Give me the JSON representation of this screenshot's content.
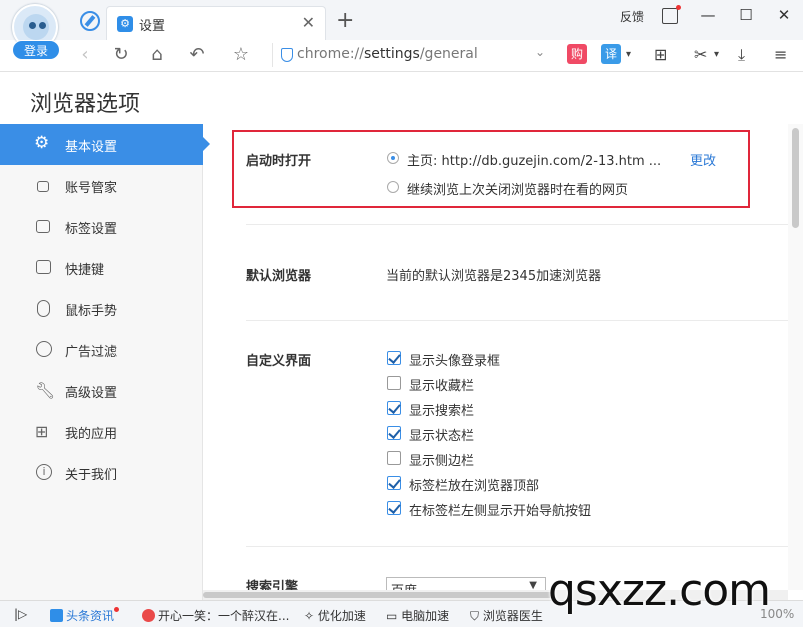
{
  "titlebar": {
    "login_label": "登录",
    "tab_title": "设置",
    "tab_close": "✕",
    "new_tab": "+",
    "feedback": "反馈",
    "minimize": "—",
    "maximize": "☐",
    "close": "✕"
  },
  "addressbar": {
    "url_scheme": "chrome://",
    "url_host": "settings",
    "url_path": "/general",
    "gou_label": "购",
    "yi_label": "译"
  },
  "page": {
    "title": "浏览器选项"
  },
  "sidebar": {
    "items": [
      {
        "label": "基本设置",
        "icon": "gear-icon"
      },
      {
        "label": "账号管家",
        "icon": "lock-icon"
      },
      {
        "label": "标签设置",
        "icon": "tabs-icon"
      },
      {
        "label": "快捷键",
        "icon": "keyboard-icon"
      },
      {
        "label": "鼠标手势",
        "icon": "mouse-icon"
      },
      {
        "label": "广告过滤",
        "icon": "block-icon"
      },
      {
        "label": "高级设置",
        "icon": "wrench-icon"
      },
      {
        "label": "我的应用",
        "icon": "apps-icon"
      },
      {
        "label": "关于我们",
        "icon": "info-icon"
      }
    ]
  },
  "startup": {
    "label": "启动时打开",
    "homepage_option": "主页: http://db.guzejin.com/2-13.htm ...",
    "change_link": "更改",
    "continue_option": "继续浏览上次关闭浏览器时在看的网页"
  },
  "default_browser": {
    "label": "默认浏览器",
    "text": "当前的默认浏览器是2345加速浏览器"
  },
  "custom_ui": {
    "label": "自定义界面",
    "options": [
      {
        "text": "显示头像登录框",
        "checked": true
      },
      {
        "text": "显示收藏栏",
        "checked": false
      },
      {
        "text": "显示搜索栏",
        "checked": true
      },
      {
        "text": "显示状态栏",
        "checked": true
      },
      {
        "text": "显示侧边栏",
        "checked": false
      },
      {
        "text": "标签栏放在浏览器顶部",
        "checked": true
      },
      {
        "text": "在标签栏左侧显示开始导航按钮",
        "checked": true
      }
    ]
  },
  "search_engine": {
    "label": "搜索引擎",
    "selected": "百度"
  },
  "statusbar": {
    "news": "头条资讯",
    "joke": "开心一笑：一个醉汉在...",
    "optimize": "优化加速",
    "pc_speed": "电脑加速",
    "doctor": "浏览器医生",
    "zoom": "100%"
  },
  "watermark": "qsxzz.com",
  "colors": {
    "accent": "#3a8ee6",
    "highlight_border": "#e0263a"
  }
}
